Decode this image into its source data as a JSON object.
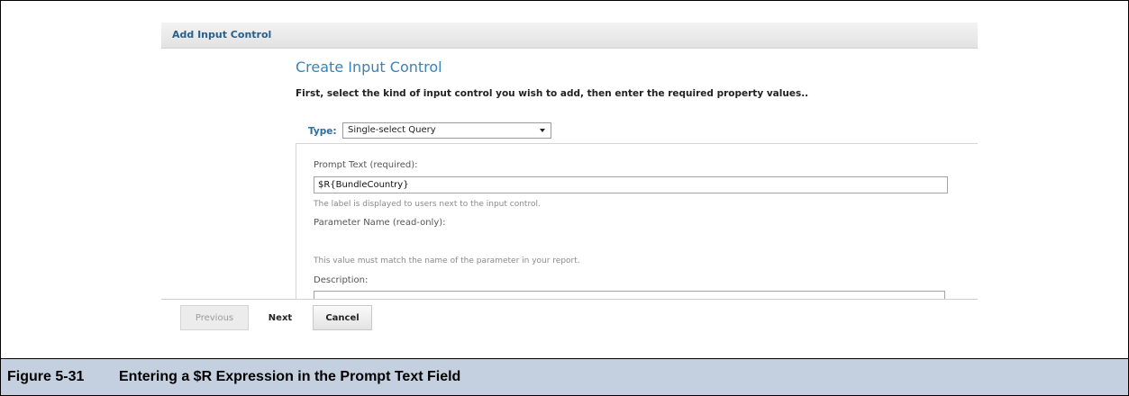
{
  "panel": {
    "title": "Add Input Control"
  },
  "form": {
    "heading": "Create Input Control",
    "instructions": "First, select the kind of input control you wish to add, then enter the required property values..",
    "type": {
      "label": "Type:",
      "selected": "Single-select Query"
    },
    "prompt_text": {
      "label": "Prompt Text (required):",
      "value": "$R{BundleCountry}",
      "hint": "The label is displayed to users next to the input control."
    },
    "parameter_name": {
      "label": "Parameter Name (read-only):",
      "value": "",
      "hint": "This value must match the name of the parameter in your report."
    },
    "description": {
      "label": "Description:",
      "value": ""
    }
  },
  "buttons": {
    "previous": "Previous",
    "next": "Next",
    "cancel": "Cancel"
  },
  "caption": {
    "number": "Figure 5-31",
    "text": "Entering a $R Expression in the Prompt Text Field"
  }
}
